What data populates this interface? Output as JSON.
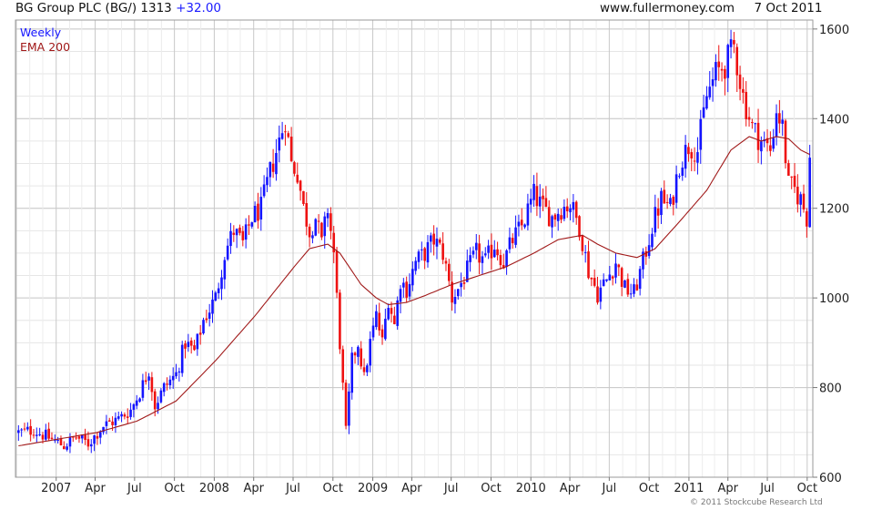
{
  "header": {
    "title": "BG Group PLC (BG/) 1313",
    "change": "+32.00",
    "source": "www.fullermoney.com",
    "date": "7 Oct 2011"
  },
  "copyright": "© 2011 Stockcube Research Ltd",
  "colors": {
    "up": "#1414ff",
    "down": "#ee1111",
    "ema": "#a01818",
    "grid": "#d9d9d9",
    "frame": "#9a9a9a"
  },
  "chart_data": {
    "type": "candlestick",
    "legend": [
      "Weekly",
      "EMA 200"
    ],
    "legend_placement": "top-left",
    "grid": true,
    "ylim": [
      600,
      1620
    ],
    "yticks": [
      600,
      800,
      1000,
      1200,
      1400,
      1600
    ],
    "x_range": [
      "2006-09-29",
      "2011-10-14"
    ],
    "xticks": [
      {
        "label": "2007",
        "date": "2007-01-01"
      },
      {
        "label": "Apr",
        "date": "2007-04-01"
      },
      {
        "label": "Jul",
        "date": "2007-07-01"
      },
      {
        "label": "Oct",
        "date": "2007-10-01"
      },
      {
        "label": "2008",
        "date": "2008-01-01"
      },
      {
        "label": "Apr",
        "date": "2008-04-01"
      },
      {
        "label": "Jul",
        "date": "2008-07-01"
      },
      {
        "label": "Oct",
        "date": "2008-10-01"
      },
      {
        "label": "2009",
        "date": "2009-01-01"
      },
      {
        "label": "Apr",
        "date": "2009-04-01"
      },
      {
        "label": "Jul",
        "date": "2009-07-01"
      },
      {
        "label": "Oct",
        "date": "2009-10-01"
      },
      {
        "label": "2010",
        "date": "2010-01-01"
      },
      {
        "label": "Apr",
        "date": "2010-04-01"
      },
      {
        "label": "Jul",
        "date": "2010-07-01"
      },
      {
        "label": "Oct",
        "date": "2010-10-01"
      },
      {
        "label": "2011",
        "date": "2011-01-01"
      },
      {
        "label": "Apr",
        "date": "2011-04-01"
      },
      {
        "label": "Jul",
        "date": "2011-07-01"
      },
      {
        "label": "Oct",
        "date": "2011-10-01"
      }
    ],
    "close_path": [
      [
        "2006-10-06",
        700
      ],
      [
        "2006-11-10",
        705
      ],
      [
        "2006-12-15",
        688
      ],
      [
        "2007-01-19",
        670
      ],
      [
        "2007-02-16",
        690
      ],
      [
        "2007-03-16",
        675
      ],
      [
        "2007-04-20",
        715
      ],
      [
        "2007-05-25",
        730
      ],
      [
        "2007-06-22",
        750
      ],
      [
        "2007-07-13",
        790
      ],
      [
        "2007-08-03",
        840
      ],
      [
        "2007-08-17",
        760
      ],
      [
        "2007-09-07",
        800
      ],
      [
        "2007-10-05",
        830
      ],
      [
        "2007-10-26",
        900
      ],
      [
        "2007-11-16",
        880
      ],
      [
        "2007-12-07",
        950
      ],
      [
        "2008-01-04",
        1000
      ],
      [
        "2008-01-25",
        1100
      ],
      [
        "2008-02-15",
        1150
      ],
      [
        "2008-03-07",
        1120
      ],
      [
        "2008-03-28",
        1180
      ],
      [
        "2008-04-18",
        1200
      ],
      [
        "2008-05-09",
        1280
      ],
      [
        "2008-05-30",
        1350
      ],
      [
        "2008-06-13",
        1400
      ],
      [
        "2008-06-27",
        1300
      ],
      [
        "2008-07-11",
        1280
      ],
      [
        "2008-07-25",
        1200
      ],
      [
        "2008-08-08",
        1150
      ],
      [
        "2008-08-22",
        1180
      ],
      [
        "2008-09-05",
        1120
      ],
      [
        "2008-09-19",
        1200
      ],
      [
        "2008-10-03",
        1100
      ],
      [
        "2008-10-17",
        900
      ],
      [
        "2008-10-31",
        700
      ],
      [
        "2008-11-14",
        860
      ],
      [
        "2008-11-28",
        900
      ],
      [
        "2008-12-12",
        820
      ],
      [
        "2008-12-26",
        900
      ],
      [
        "2009-01-09",
        960
      ],
      [
        "2009-01-23",
        900
      ],
      [
        "2009-02-06",
        1000
      ],
      [
        "2009-02-20",
        940
      ],
      [
        "2009-03-06",
        1040
      ],
      [
        "2009-03-20",
        1020
      ],
      [
        "2009-04-10",
        1080
      ],
      [
        "2009-05-01",
        1100
      ],
      [
        "2009-05-22",
        1130
      ],
      [
        "2009-06-12",
        1100
      ],
      [
        "2009-07-03",
        1000
      ],
      [
        "2009-07-17",
        1020
      ],
      [
        "2009-08-07",
        1060
      ],
      [
        "2009-08-28",
        1100
      ],
      [
        "2009-09-18",
        1080
      ],
      [
        "2009-10-09",
        1120
      ],
      [
        "2009-10-30",
        1080
      ],
      [
        "2009-11-20",
        1130
      ],
      [
        "2009-12-11",
        1160
      ],
      [
        "2010-01-08",
        1230
      ],
      [
        "2010-01-29",
        1200
      ],
      [
        "2010-02-19",
        1180
      ],
      [
        "2010-03-12",
        1200
      ],
      [
        "2010-04-02",
        1210
      ],
      [
        "2010-04-23",
        1160
      ],
      [
        "2010-05-14",
        1060
      ],
      [
        "2010-06-04",
        1010
      ],
      [
        "2010-06-25",
        1040
      ],
      [
        "2010-07-16",
        1080
      ],
      [
        "2010-08-06",
        1020
      ],
      [
        "2010-08-27",
        1010
      ],
      [
        "2010-09-17",
        1080
      ],
      [
        "2010-10-08",
        1160
      ],
      [
        "2010-10-29",
        1220
      ],
      [
        "2010-11-19",
        1200
      ],
      [
        "2010-12-10",
        1300
      ],
      [
        "2010-12-31",
        1340
      ],
      [
        "2011-01-21",
        1330
      ],
      [
        "2011-02-11",
        1450
      ],
      [
        "2011-03-04",
        1500
      ],
      [
        "2011-03-25",
        1520
      ],
      [
        "2011-04-15",
        1560
      ],
      [
        "2011-05-06",
        1450
      ],
      [
        "2011-05-27",
        1380
      ],
      [
        "2011-06-17",
        1350
      ],
      [
        "2011-07-08",
        1330
      ],
      [
        "2011-07-22",
        1420
      ],
      [
        "2011-08-05",
        1380
      ],
      [
        "2011-08-19",
        1250
      ],
      [
        "2011-09-02",
        1240
      ],
      [
        "2011-09-16",
        1220
      ],
      [
        "2011-09-30",
        1180
      ],
      [
        "2011-10-07",
        1313
      ]
    ],
    "ema_path": [
      [
        "2006-10-06",
        670
      ],
      [
        "2007-01-05",
        685
      ],
      [
        "2007-04-06",
        700
      ],
      [
        "2007-07-06",
        725
      ],
      [
        "2007-10-05",
        770
      ],
      [
        "2008-01-04",
        860
      ],
      [
        "2008-04-04",
        960
      ],
      [
        "2008-07-04",
        1070
      ],
      [
        "2008-08-08",
        1110
      ],
      [
        "2008-09-19",
        1120
      ],
      [
        "2008-10-17",
        1100
      ],
      [
        "2008-12-05",
        1030
      ],
      [
        "2009-01-09",
        1000
      ],
      [
        "2009-02-06",
        985
      ],
      [
        "2009-03-20",
        990
      ],
      [
        "2009-05-01",
        1005
      ],
      [
        "2009-07-03",
        1030
      ],
      [
        "2009-09-04",
        1050
      ],
      [
        "2009-11-06",
        1070
      ],
      [
        "2010-01-08",
        1100
      ],
      [
        "2010-03-05",
        1130
      ],
      [
        "2010-04-30",
        1140
      ],
      [
        "2010-06-04",
        1120
      ],
      [
        "2010-07-16",
        1100
      ],
      [
        "2010-09-03",
        1090
      ],
      [
        "2010-10-15",
        1110
      ],
      [
        "2010-12-10",
        1170
      ],
      [
        "2011-02-11",
        1240
      ],
      [
        "2011-04-08",
        1330
      ],
      [
        "2011-05-20",
        1360
      ],
      [
        "2011-06-17",
        1350
      ],
      [
        "2011-07-22",
        1360
      ],
      [
        "2011-08-19",
        1355
      ],
      [
        "2011-09-16",
        1330
      ],
      [
        "2011-10-07",
        1320
      ]
    ]
  }
}
